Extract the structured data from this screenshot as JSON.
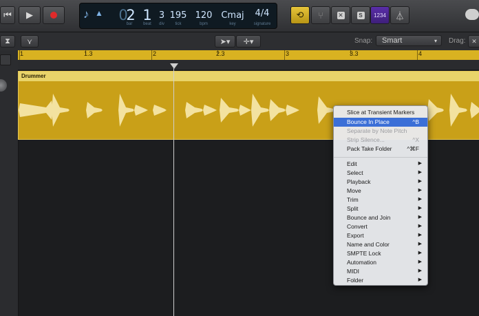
{
  "transport": {
    "rewind_icon": "rewind-icon",
    "play_icon": "play-icon",
    "record_icon": "record-icon"
  },
  "lcd": {
    "bar": "2",
    "beat": "1",
    "div": "3",
    "tick": "195",
    "bpm": "120",
    "key": "Cmaj",
    "signature": "4/4",
    "bar_label": "bar",
    "beat_label": "beat",
    "div_label": "div",
    "tick_label": "tick",
    "bpm_label": "bpm",
    "key_label": "key",
    "signature_label": "signature",
    "count_in": "1234"
  },
  "toolbar": {
    "snap_label": "Snap:",
    "snap_value": "Smart",
    "drag_label": "Drag:"
  },
  "ruler": {
    "marks": [
      "1",
      "1.3",
      "2",
      "2.3",
      "3",
      "3.3",
      "4"
    ]
  },
  "region": {
    "name": "Drummer",
    "color": "#c9a018"
  },
  "menu": {
    "items": [
      {
        "label": "Slice at Transient Markers",
        "shortcut": ""
      },
      {
        "label": "Bounce In Place",
        "shortcut": "^B"
      },
      {
        "label": "Separate by Note Pitch",
        "shortcut": ""
      },
      {
        "label": "Strip Silence...",
        "shortcut": "^X"
      },
      {
        "label": "Pack Take Folder",
        "shortcut": "^⌘F"
      }
    ],
    "submenus": [
      "Edit",
      "Select",
      "Playback",
      "Move",
      "Trim",
      "Split",
      "Bounce and Join",
      "Convert",
      "Export",
      "Name and Color",
      "SMPTE Lock",
      "Automation",
      "MIDI",
      "Folder"
    ],
    "highlight_color": "#3b6fd7"
  }
}
